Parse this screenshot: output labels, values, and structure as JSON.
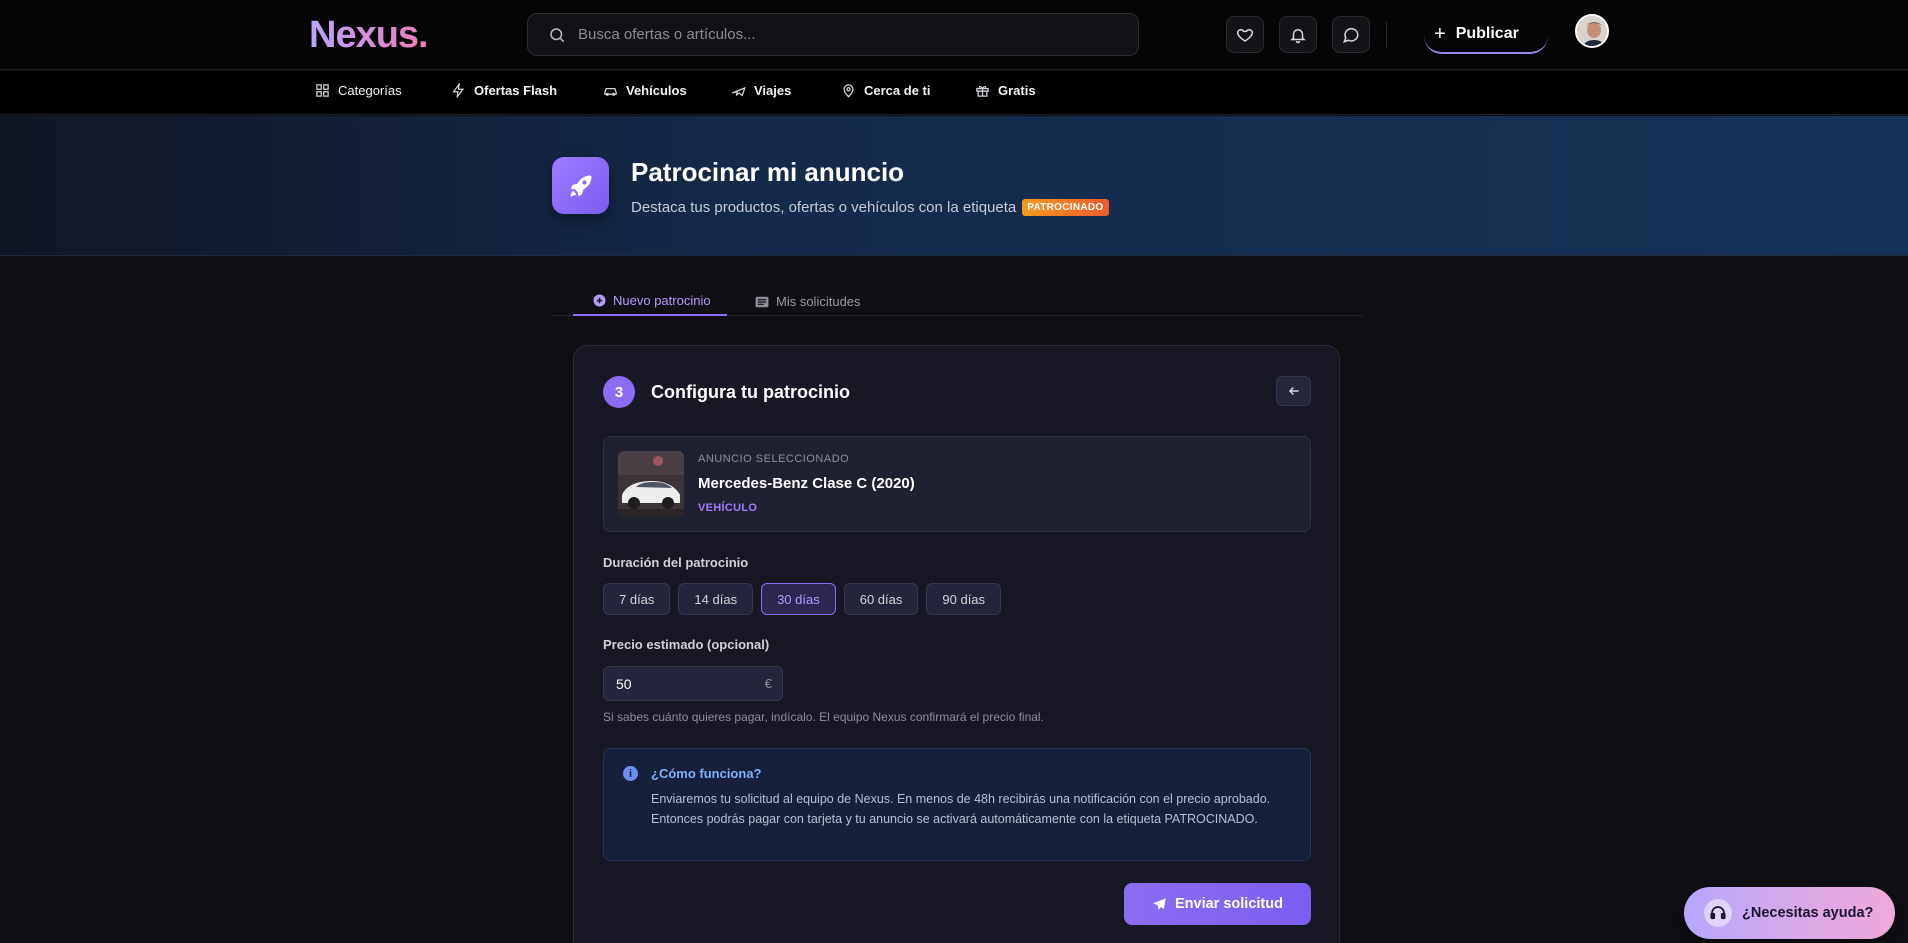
{
  "header": {
    "logo": "Nexus.",
    "search_placeholder": "Busca ofertas o artículos...",
    "publish_label": "Publicar"
  },
  "nav": {
    "items": [
      {
        "label": "Categorías",
        "icon": "grid-icon"
      },
      {
        "label": "Ofertas Flash",
        "icon": "lightning-icon"
      },
      {
        "label": "Vehículos",
        "icon": "car-icon"
      },
      {
        "label": "Viajes",
        "icon": "plane-icon"
      },
      {
        "label": "Cerca de ti",
        "icon": "map-pin-icon"
      },
      {
        "label": "Gratis",
        "icon": "gift-icon"
      }
    ]
  },
  "hero": {
    "title": "Patrocinar mi anuncio",
    "subtitle": "Destaca tus productos, ofertas o vehículos con la etiqueta",
    "badge": "PATROCINADO"
  },
  "tabs": {
    "new": "Nuevo patrocinio",
    "mine": "Mis solicitudes"
  },
  "card": {
    "step": "3",
    "title": "Configura tu patrocinio",
    "selected_caption": "ANUNCIO SELECCIONADO",
    "selected_title": "Mercedes-Benz Clase C (2020)",
    "selected_type": "VEHÍCULO",
    "duration_label": "Duración del patrocinio",
    "durations": [
      "7 días",
      "14 días",
      "30 días",
      "60 días",
      "90 días"
    ],
    "duration_selected": "30 días",
    "price_label": "Precio estimado (opcional)",
    "price_value": "50",
    "currency": "€",
    "price_hint": "Si sabes cuánto quieres pagar, indícalo. El equipo Nexus confirmará el precio final.",
    "info_title": "¿Cómo funciona?",
    "info_body": "Enviaremos tu solicitud al equipo de Nexus. En menos de 48h recibirás una notificación con el precio aprobado. Entonces podrás pagar con tarjeta y tu anuncio se activará automáticamente con la etiqueta PATROCINADO.",
    "send_label": "Enviar solicitud"
  },
  "help": {
    "label": "¿Necesitas ayuda?"
  },
  "colors": {
    "accent": "#8c6cf2",
    "badge_start": "#f39a1f",
    "badge_end": "#ec5b2a",
    "info": "#7fb0ff"
  }
}
